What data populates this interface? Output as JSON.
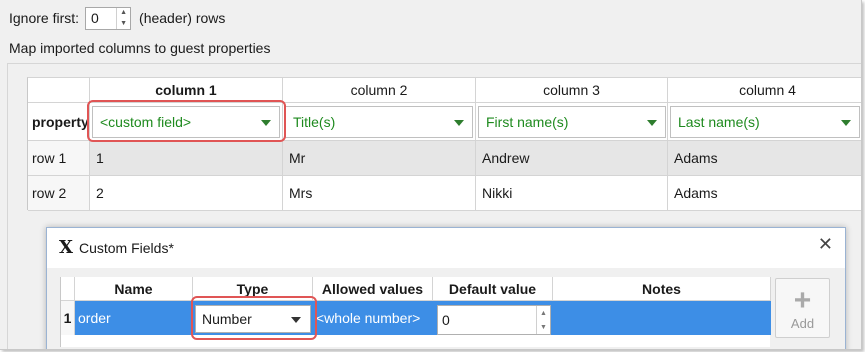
{
  "import": {
    "ignore_first_label": "Ignore first:",
    "ignore_first_value": "0",
    "ignore_first_suffix": "(header) rows",
    "map_label": "Map imported columns to guest properties"
  },
  "grid": {
    "columns": [
      "column 1",
      "column 2",
      "column 3",
      "column 4"
    ],
    "property_label": "property",
    "properties": [
      "<custom field>",
      "Title(s)",
      "First name(s)",
      "Last name(s)"
    ],
    "rows": [
      {
        "label": "row 1",
        "cells": [
          "1",
          "Mr",
          "Andrew",
          "Adams"
        ]
      },
      {
        "label": "row 2",
        "cells": [
          "2",
          "Mrs",
          "Nikki",
          "Adams"
        ]
      }
    ]
  },
  "dialog": {
    "title": "Custom Fields*",
    "close_glyph": "✕",
    "headers": [
      "Name",
      "Type",
      "Allowed values",
      "Default value",
      "Notes"
    ],
    "row": {
      "index": "1",
      "name": "order",
      "type": "Number",
      "allowed": "<whole number>",
      "default": "0",
      "notes": ""
    },
    "add_label": "Add"
  },
  "colors": {
    "accent_green": "#1e8a1e",
    "selection_blue": "#3d8ee6",
    "highlight_red": "#e05555"
  }
}
